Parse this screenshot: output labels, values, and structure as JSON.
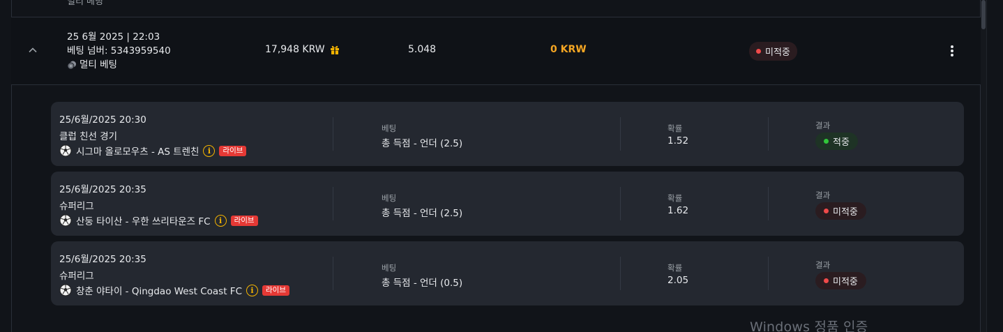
{
  "top_sliver": {
    "text": "멀티 베팅"
  },
  "bet": {
    "datetime": "25 6월 2025 | 22:03",
    "bet_number": "베팅 넘버: 5343959540",
    "bet_type": "멀티 베팅",
    "stake": "17,948 KRW",
    "total_odds": "5.048",
    "payout": "0 KRW",
    "status": "미적중",
    "status_color": "#f04a4a",
    "payout_color": "#f5a623"
  },
  "legs": [
    {
      "datetime": "25/6월/2025 20:30",
      "league": "클럽 친선 경기",
      "match": "시그마 올로모우츠 - AS 트렌친",
      "live": "라이브",
      "bet_label": "베팅",
      "bet_value": "총 득점 - 언더 (2.5)",
      "odds_label": "확률",
      "odds_value": "1.52",
      "result_label": "결과",
      "result_value": "적중",
      "result_color": "#31c73a"
    },
    {
      "datetime": "25/6월/2025 20:35",
      "league": "슈퍼리그",
      "match": "산둥 타이산 - 우한 쓰리타운즈 FC",
      "live": "라이브",
      "bet_label": "베팅",
      "bet_value": "총 득점 - 언더 (2.5)",
      "odds_label": "확률",
      "odds_value": "1.62",
      "result_label": "결과",
      "result_value": "미적중",
      "result_color": "#f04a4a"
    },
    {
      "datetime": "25/6월/2025 20:35",
      "league": "슈퍼리그",
      "match": "창춘 야타이 - Qingdao West Coast FC",
      "live": "라이브",
      "bet_label": "베팅",
      "bet_value": "총 득점 - 언더 (0.5)",
      "odds_label": "확률",
      "odds_value": "2.05",
      "result_label": "결과",
      "result_value": "미적중",
      "result_color": "#f04a4a"
    }
  ],
  "watermark": "Windows 정품 인증",
  "icons": {
    "collapse": "chevron-up-icon",
    "bet_type": "chips-icon",
    "bonus": "gift-icon",
    "menu": "kebab-menu-icon",
    "sport": "soccer-ball-icon",
    "info": "info-icon"
  }
}
